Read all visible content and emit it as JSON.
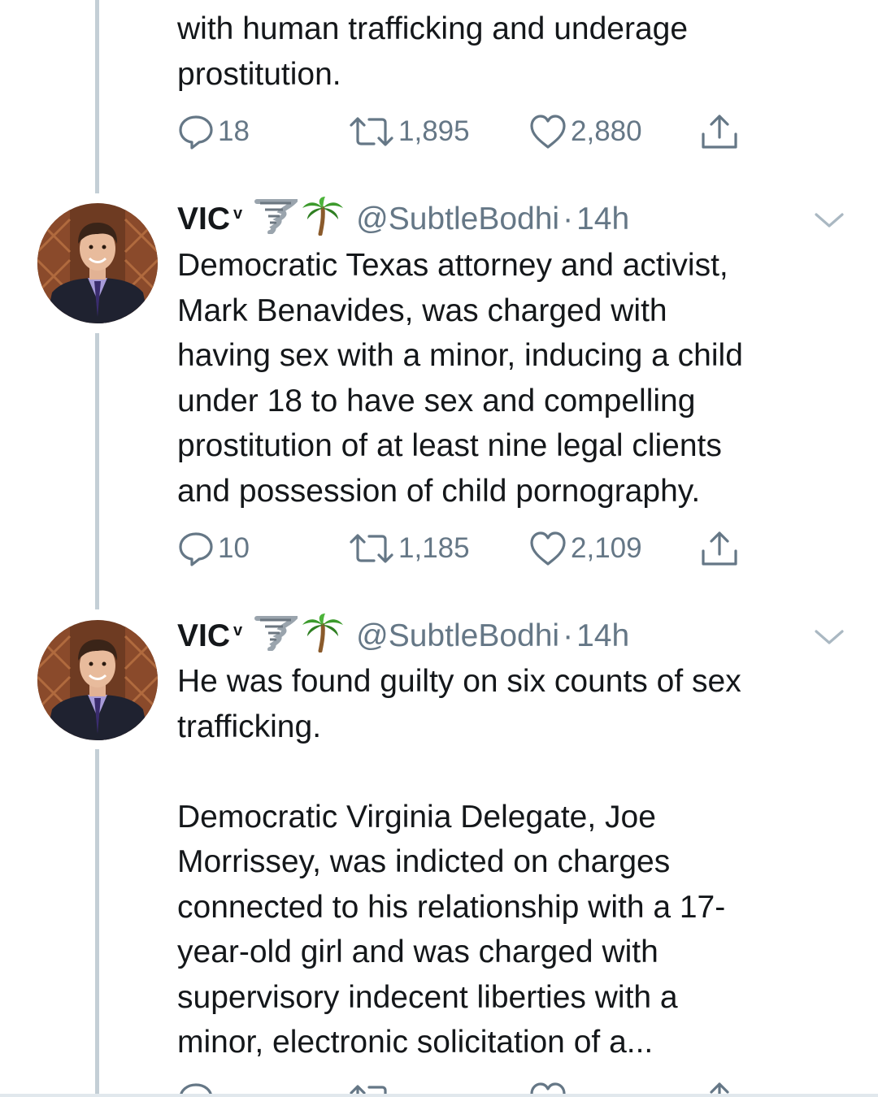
{
  "tweet_top": {
    "text_lines": [
      "with human trafficking and underage",
      "prostitution."
    ],
    "replies": "18",
    "retweets": "1,895",
    "likes": "2,880"
  },
  "tweet_2": {
    "name": "VIC",
    "verified_mark": "v",
    "emojis": [
      "tornado-emoji",
      "palm-tree-emoji"
    ],
    "handle": "@SubtleBodhi",
    "separator": "·",
    "time": "14h",
    "text_lines": [
      "Democratic Texas attorney and activist,",
      "Mark Benavides, was charged with",
      "having sex with a minor, inducing a child",
      "under 18 to have sex and compelling",
      "prostitution of at least nine legal clients",
      "and possession of child pornography."
    ],
    "replies": "10",
    "retweets": "1,185",
    "likes": "2,109"
  },
  "tweet_3": {
    "name": "VIC",
    "verified_mark": "v",
    "emojis": [
      "tornado-emoji",
      "palm-tree-emoji"
    ],
    "handle": "@SubtleBodhi",
    "separator": "·",
    "time": "14h",
    "text_lines_a": [
      "He was found guilty on six counts of sex",
      "trafficking."
    ],
    "text_lines_b": [
      "Democratic Virginia Delegate, Joe",
      "Morrissey, was indicted on charges",
      "connected to his relationship with a 17-",
      "year-old girl and was charged with",
      "supervisory indecent liberties with a",
      "minor, electronic solicitation of a..."
    ]
  },
  "colors": {
    "text": "#14171a",
    "secondary": "#657786",
    "thread_line": "#c4cfd6",
    "background": "#ffffff"
  },
  "icons": [
    "reply-icon",
    "retweet-icon",
    "like-icon",
    "share-icon",
    "chevron-down-icon"
  ]
}
